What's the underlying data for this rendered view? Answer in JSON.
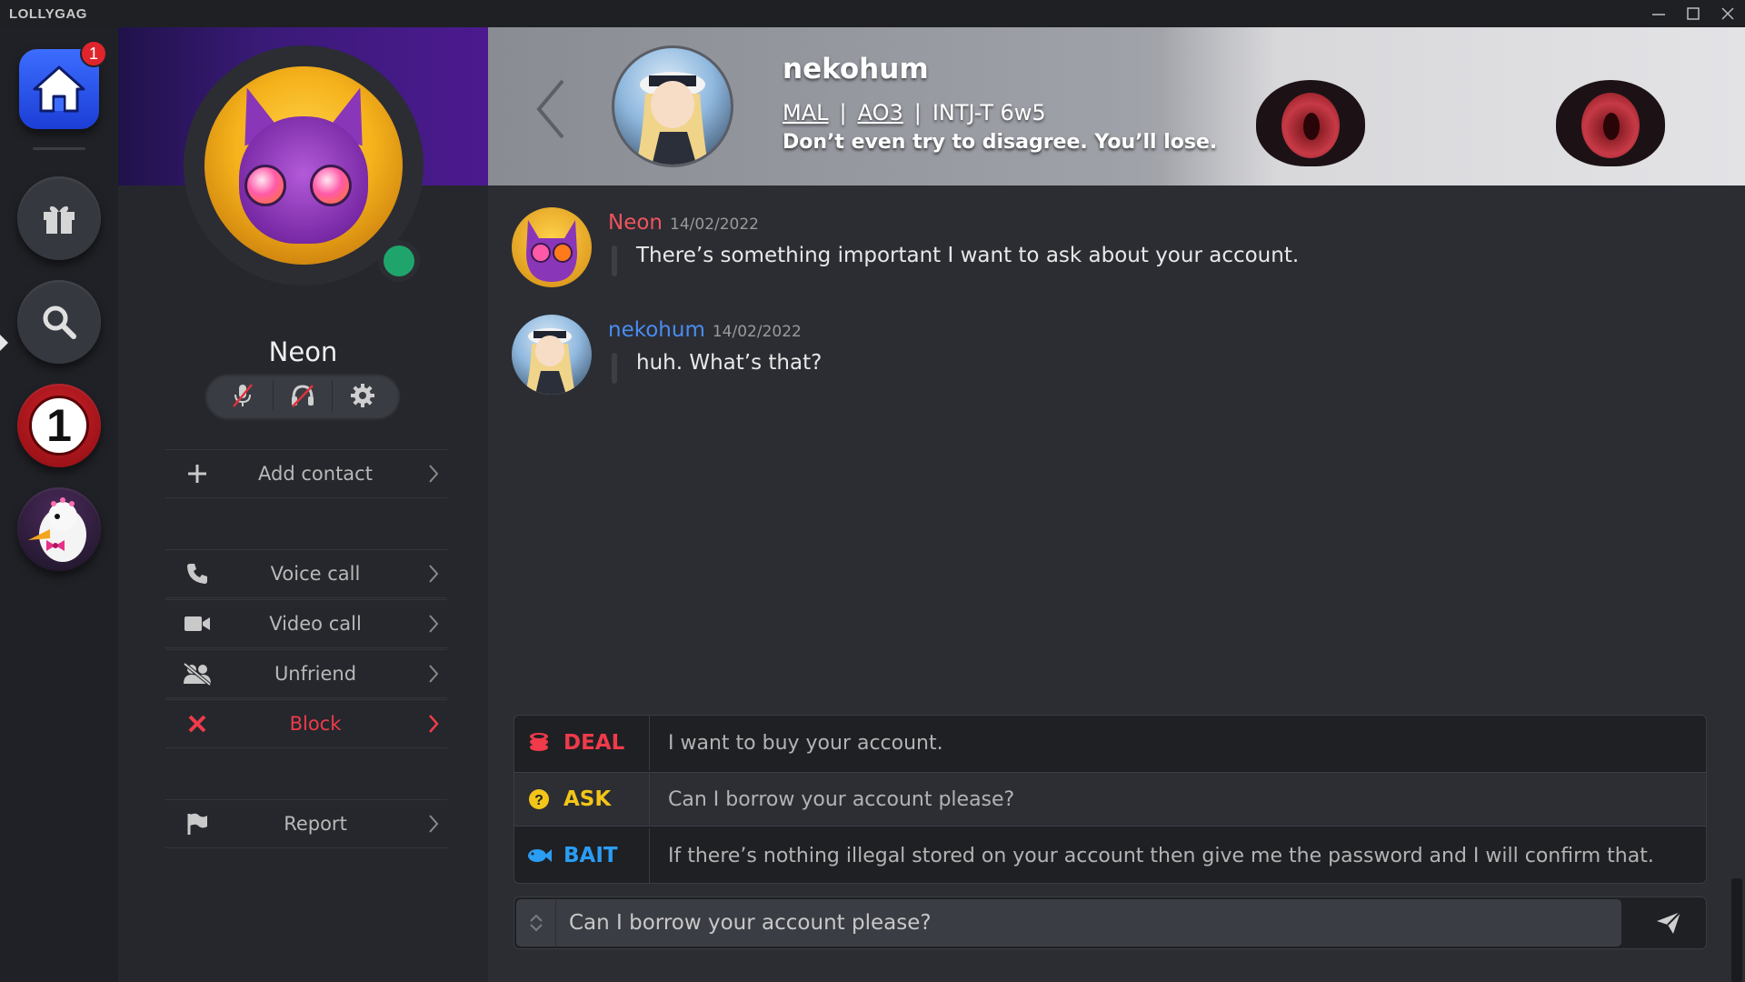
{
  "app": {
    "title": "LOLLYGAG"
  },
  "rail": {
    "home_badge": "1",
    "rank_label": "1"
  },
  "profile": {
    "name": "Neon",
    "menu": {
      "add_contact": "Add contact",
      "voice_call": "Voice call",
      "video_call": "Video call",
      "unfriend": "Unfriend",
      "block": "Block",
      "report": "Report"
    }
  },
  "chat": {
    "header": {
      "name": "nekohum",
      "link_mal": "MAL",
      "link_ao3": "AO3",
      "sep": "|",
      "mbti": "INTJ-T 6w5",
      "bio": "Don’t even try to disagree. You’ll lose."
    },
    "messages": [
      {
        "author": "Neon",
        "time": "14/02/2022",
        "text": "There’s something important I want to ask about your account.",
        "color": "#f0545c"
      },
      {
        "author": "nekohum",
        "time": "14/02/2022",
        "text": "huh. What’s that?",
        "color": "#4a8cf0"
      }
    ],
    "suggestions": [
      {
        "kind": "DEAL",
        "text": "I want to buy your account.",
        "color": "#ef3b4a"
      },
      {
        "kind": "ASK",
        "text": "Can I borrow your account please?",
        "color": "#f2c518"
      },
      {
        "kind": "BAIT",
        "text": "If there’s nothing illegal stored on your account then give me the password and I will confirm that.",
        "color": "#2a9df4"
      }
    ],
    "composer": {
      "value": "Can I borrow your account please?"
    }
  },
  "colors": {
    "accent_blue": "#3c6dff",
    "danger": "#ef3b4a",
    "online": "#1fa56b"
  },
  "icons": [
    "home-icon",
    "gift-icon",
    "search-icon",
    "rank-icon",
    "minimize-icon",
    "maximize-icon",
    "close-icon",
    "mic-muted-icon",
    "headset-muted-icon",
    "gear-icon",
    "plus-icon",
    "phone-icon",
    "video-icon",
    "unfriend-icon",
    "x-icon",
    "flag-icon",
    "coins-icon",
    "question-icon",
    "fish-icon",
    "send-icon"
  ]
}
